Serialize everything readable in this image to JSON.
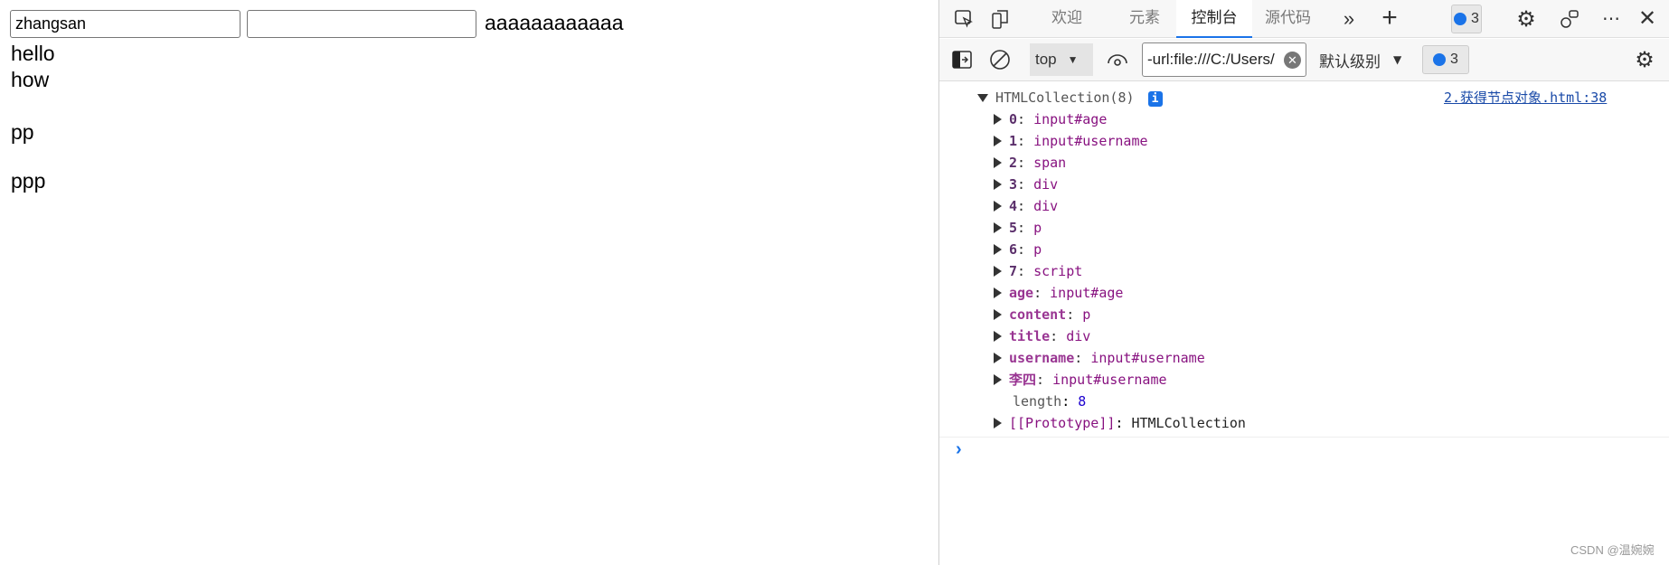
{
  "page": {
    "input1_value": "zhangsan",
    "input2_value": "",
    "span_text": "aaaaaaaaaaaa",
    "div1": "hello",
    "div2": "how",
    "p1": "pp",
    "p2": "ppp"
  },
  "devtools": {
    "tabs": [
      {
        "label": "欢迎",
        "active": false
      },
      {
        "label": "元素",
        "active": false
      },
      {
        "label": "控制台",
        "active": true
      },
      {
        "label": "源代码",
        "active": false
      }
    ],
    "issues_count": "3",
    "context": "top",
    "filter_value": "-url:file:///C:/Users/",
    "level_label": "默认级别",
    "filter_issues_count": "3",
    "console": {
      "header": "HTMLCollection(8)",
      "source_link": "2.获得节点对象.html:38",
      "entries": [
        {
          "key": "0",
          "value": "input#age"
        },
        {
          "key": "1",
          "value": "input#username"
        },
        {
          "key": "2",
          "value": "span"
        },
        {
          "key": "3",
          "value": "div"
        },
        {
          "key": "4",
          "value": "div"
        },
        {
          "key": "5",
          "value": "p"
        },
        {
          "key": "6",
          "value": "p"
        },
        {
          "key": "7",
          "value": "script"
        },
        {
          "key": "age",
          "value": "input#age"
        },
        {
          "key": "content",
          "value": "p"
        },
        {
          "key": "title",
          "value": "div"
        },
        {
          "key": "username",
          "value": "input#username"
        },
        {
          "key": "李四",
          "value": "input#username"
        }
      ],
      "length_key": "length",
      "length_value": "8",
      "prototype_key": "[[Prototype]]",
      "prototype_value": "HTMLCollection"
    },
    "accent_color": "#1a73e8"
  },
  "watermark": "CSDN @温婉婉"
}
